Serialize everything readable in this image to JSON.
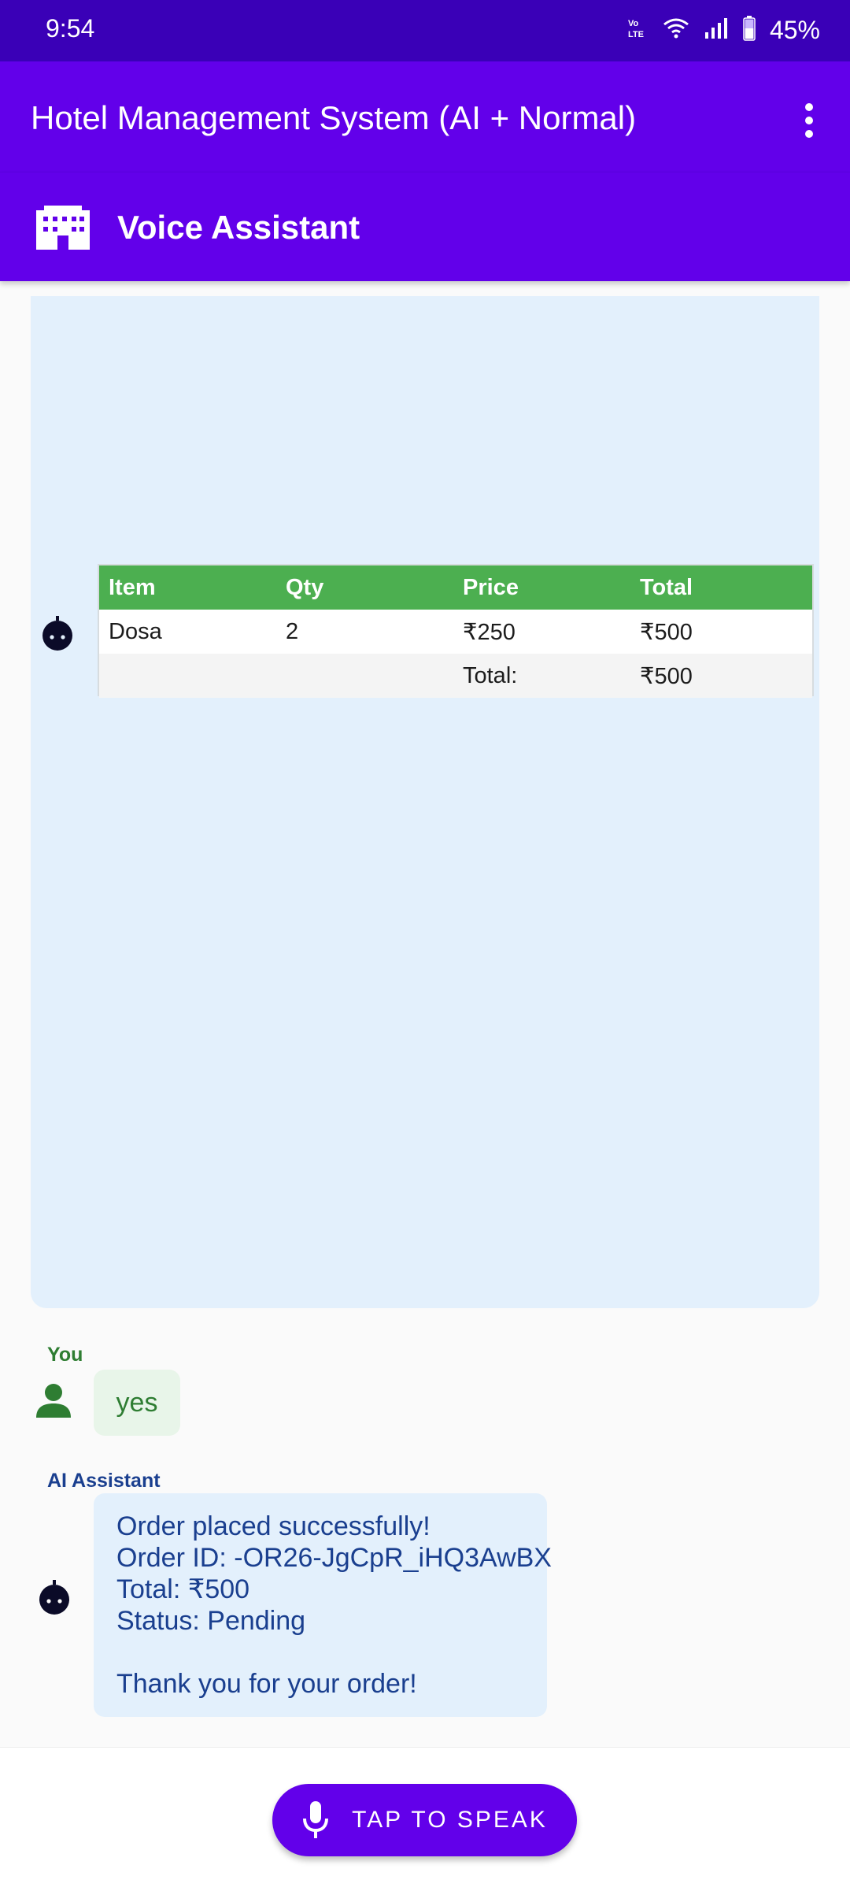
{
  "status_bar": {
    "time": "9:54",
    "network_label": "VoLTE",
    "battery": "45%",
    "icons": [
      "volte-icon",
      "wifi-icon",
      "signal-icon",
      "battery-icon"
    ]
  },
  "app_bar": {
    "title": "Hotel Management System (AI + Normal)",
    "menu_icon": "more-vert-icon"
  },
  "sub_bar": {
    "title": "Voice Assistant",
    "icon": "hotel-building-icon"
  },
  "chat": {
    "bot_table": {
      "headers": [
        "Item",
        "Qty",
        "Price",
        "Total"
      ],
      "rows": [
        [
          "Dosa",
          "2",
          "₹250",
          "₹500"
        ]
      ],
      "footer": [
        "",
        "",
        "Total:",
        "₹500"
      ]
    },
    "user_message": {
      "sender": "You",
      "text": "yes"
    },
    "ai_message": {
      "sender": "AI Assistant",
      "lines": [
        "Order placed successfully!",
        "Order ID: -OR26-JgCpR_iHQ3AwBX",
        "Total: ₹500",
        "Status: Pending",
        "",
        "Thank you for your order!"
      ]
    }
  },
  "bottom": {
    "speak_label": "TAP TO SPEAK",
    "mic_icon": "mic-icon"
  },
  "colors": {
    "status_bar": "#3a00b7",
    "primary": "#6200ea",
    "table_header": "#4caf50",
    "bot_bubble": "#e3f0fc",
    "user_bubble": "#e8f5e9",
    "user_text": "#2e7d32",
    "ai_text": "#1a3f8f"
  }
}
